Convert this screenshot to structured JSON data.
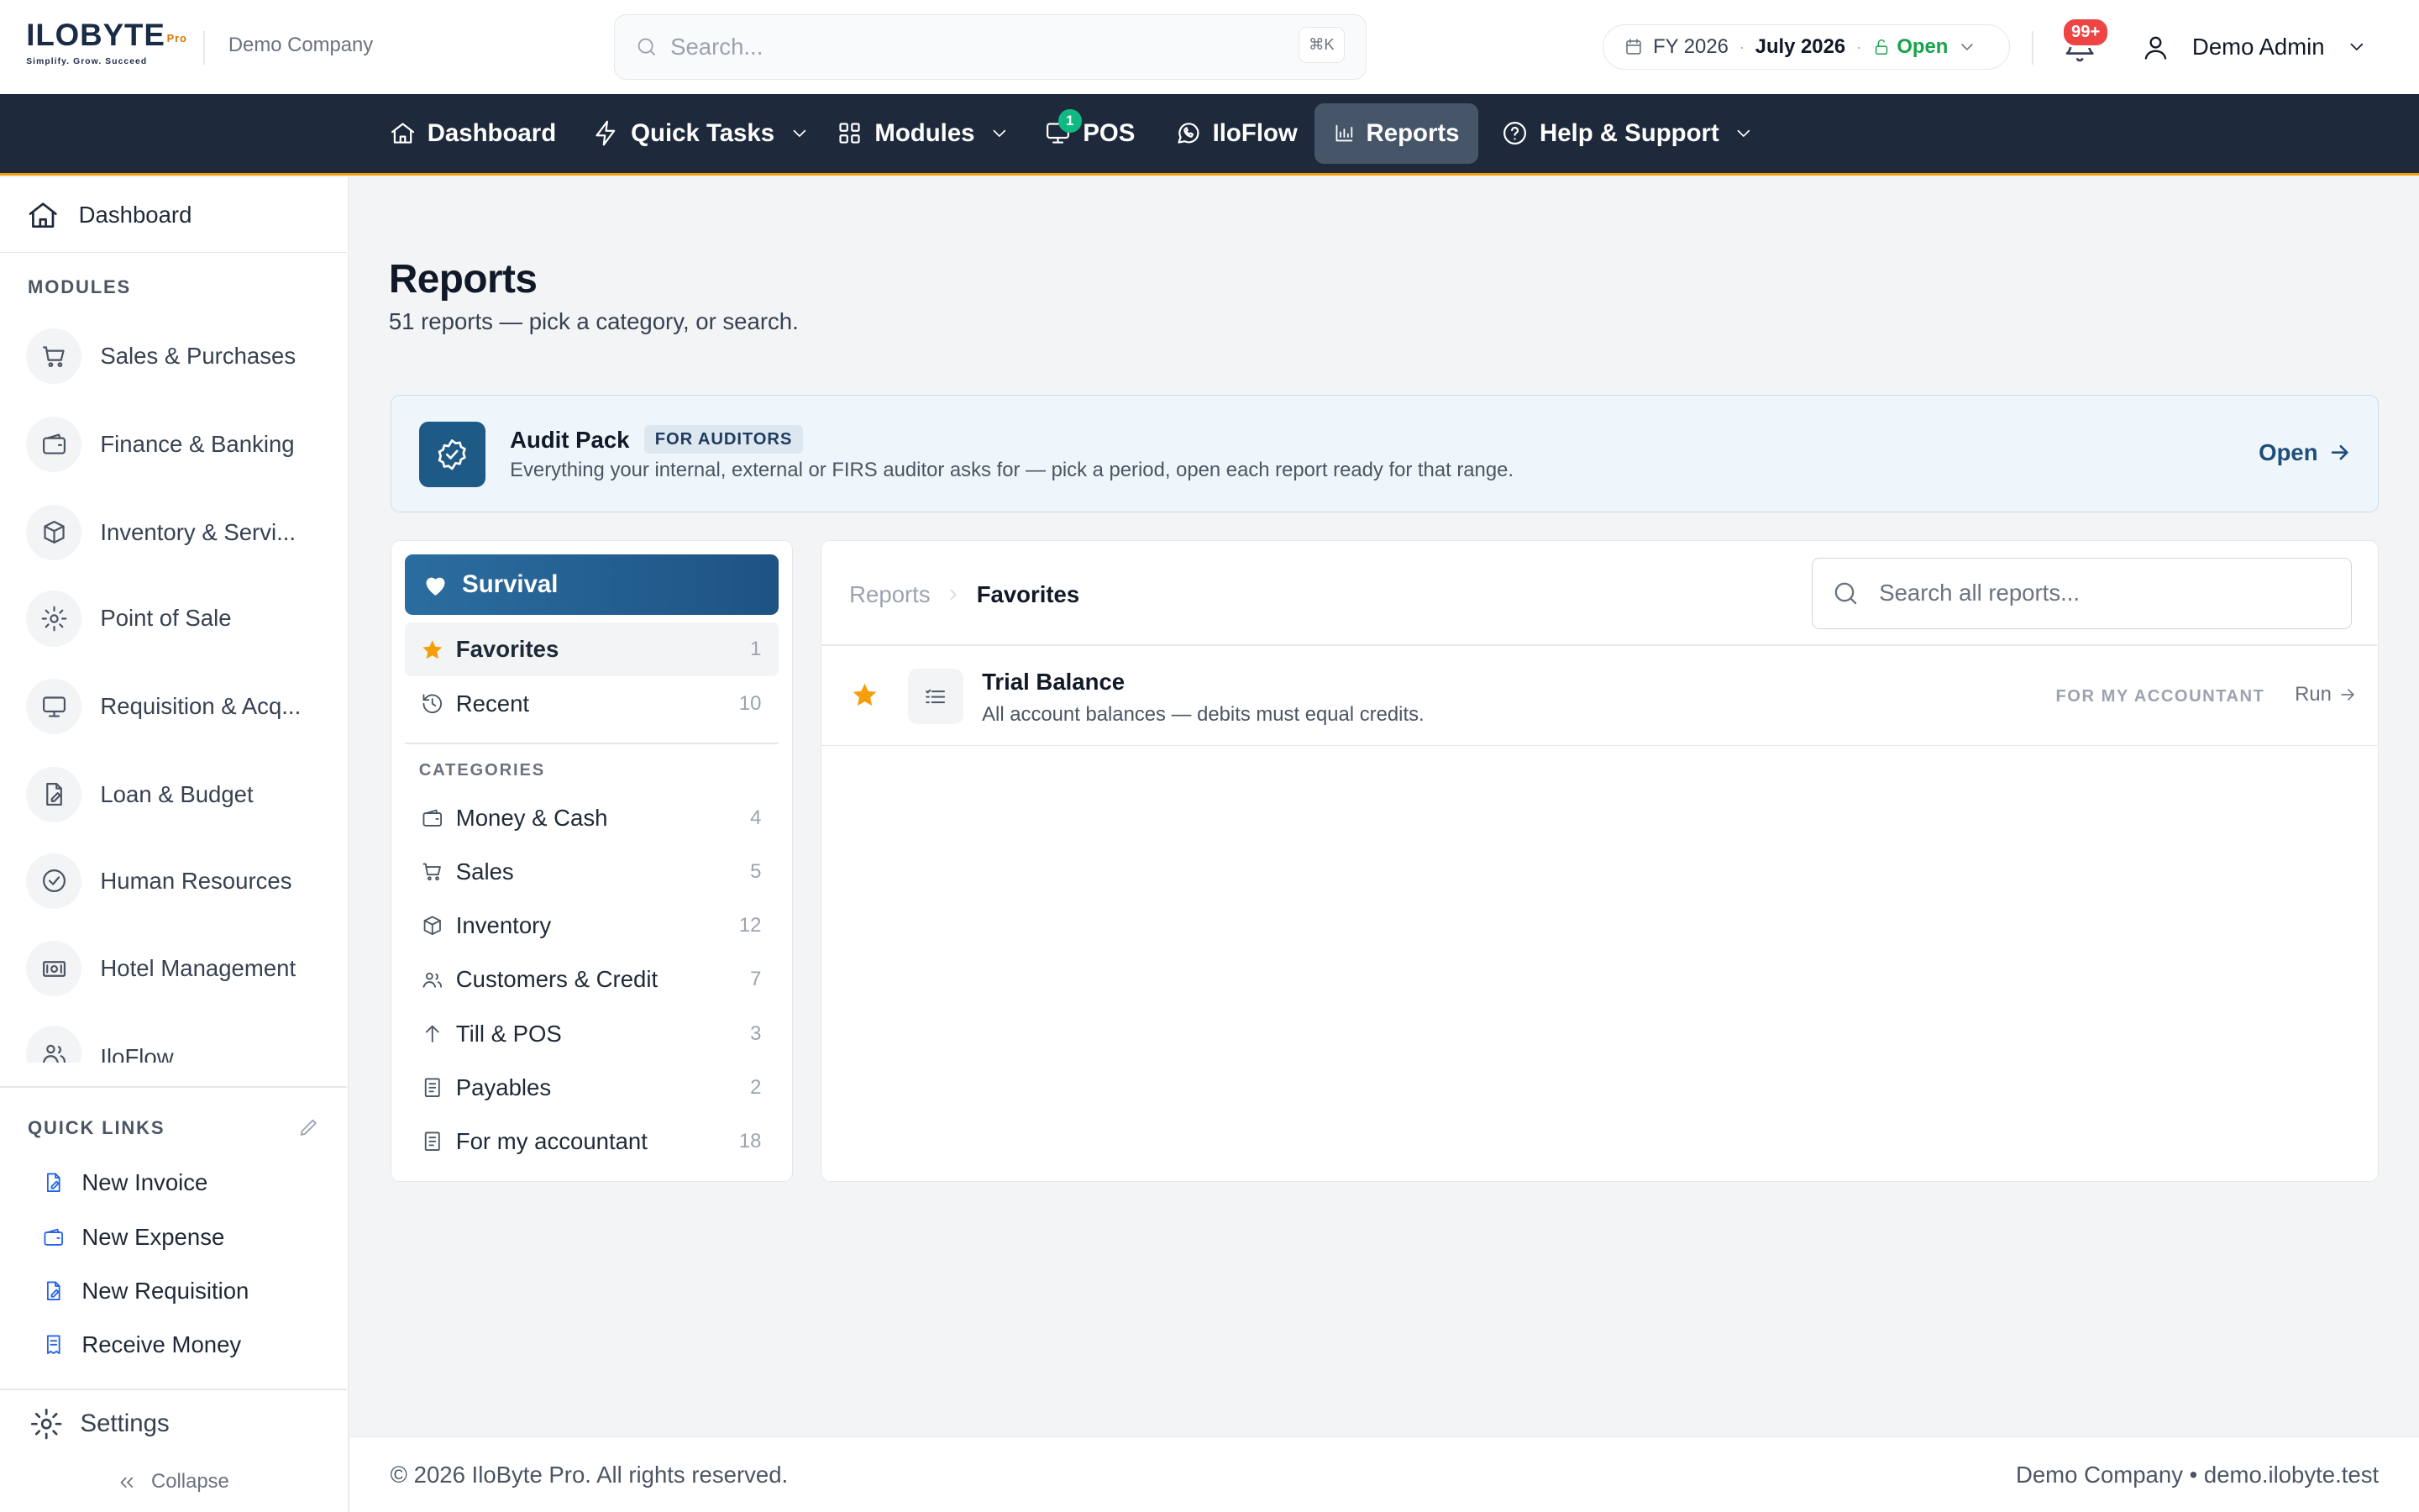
{
  "header": {
    "logo": {
      "brand": "ILOBYTE",
      "pro": "Pro",
      "tagline": "Simplify. Grow. Succeed"
    },
    "company": "Demo Company",
    "search": {
      "placeholder": "Search...",
      "shortcut": "⌘K"
    },
    "period": {
      "fy": "FY 2026",
      "month": "July 2026",
      "status": "Open"
    },
    "notifications": "99+",
    "user": "Demo Admin"
  },
  "nav": {
    "dashboard": "Dashboard",
    "quick_tasks": "Quick Tasks",
    "modules": "Modules",
    "pos": "POS",
    "pos_badge": "1",
    "iloflow": "IloFlow",
    "reports": "Reports",
    "help": "Help & Support"
  },
  "sidebar": {
    "dashboard": "Dashboard",
    "modules_heading": "MODULES",
    "modules": [
      {
        "label": "Sales & Purchases",
        "icon": "cart-icon"
      },
      {
        "label": "Finance & Banking",
        "icon": "wallet-icon"
      },
      {
        "label": "Inventory & Servi...",
        "icon": "box-icon"
      },
      {
        "label": "Point of Sale",
        "icon": "gear-icon"
      },
      {
        "label": "Requisition & Acq...",
        "icon": "monitor-icon"
      },
      {
        "label": "Loan & Budget",
        "icon": "file-edit-icon"
      },
      {
        "label": "Human Resources",
        "icon": "check-circle-icon"
      },
      {
        "label": "Hotel Management",
        "icon": "cash-icon"
      },
      {
        "label": "IloFlow",
        "icon": "users-icon"
      }
    ],
    "quick_links_heading": "QUICK LINKS",
    "quick_links": [
      "New Invoice",
      "New Expense",
      "New Requisition",
      "Receive Money"
    ],
    "settings": "Settings",
    "collapse": "Collapse"
  },
  "main": {
    "title": "Reports",
    "subtitle": "51 reports — pick a category, or search.",
    "audit": {
      "title": "Audit Pack",
      "badge": "FOR AUDITORS",
      "description": "Everything your internal, external or FIRS auditor asks for — pick a period, open each report ready for that range.",
      "open": "Open"
    },
    "categories": {
      "survival": "Survival",
      "top": [
        {
          "label": "Favorites",
          "count": "1"
        },
        {
          "label": "Recent",
          "count": "10"
        }
      ],
      "heading": "CATEGORIES",
      "items": [
        {
          "label": "Money & Cash",
          "count": "4"
        },
        {
          "label": "Sales",
          "count": "5"
        },
        {
          "label": "Inventory",
          "count": "12"
        },
        {
          "label": "Customers & Credit",
          "count": "7"
        },
        {
          "label": "Till & POS",
          "count": "3"
        },
        {
          "label": "Payables",
          "count": "2"
        },
        {
          "label": "For my accountant",
          "count": "18"
        }
      ]
    },
    "list": {
      "breadcrumb": [
        "Reports",
        "Favorites"
      ],
      "search_placeholder": "Search all reports...",
      "rows": [
        {
          "title": "Trial Balance",
          "description": "All account balances — debits must equal credits.",
          "category": "FOR MY ACCOUNTANT",
          "action": "Run"
        }
      ]
    }
  },
  "footer": {
    "copyright": "© 2026 IloByte Pro. All rights reserved.",
    "right": "Demo Company • demo.ilobyte.test"
  },
  "colors": {
    "nav_bg": "#1e293b",
    "accent": "#1e5a86",
    "nav_underline": "#f59e0b",
    "open_green": "#16a34a",
    "badge_red": "#ef4444"
  }
}
